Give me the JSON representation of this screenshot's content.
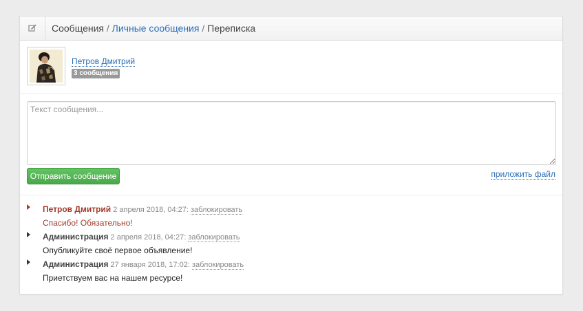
{
  "breadcrumb": {
    "root": "Сообщения",
    "sep1": "/",
    "middle": "Личные сообщения",
    "sep2": "/",
    "current": "Переписка"
  },
  "header": {
    "icon": "edit-icon"
  },
  "user": {
    "name": "Петров Дмитрий",
    "messages_count_badge": "3 сообщения",
    "avatar_icon": "avatar-photo"
  },
  "compose": {
    "placeholder": "Текст сообщения...",
    "value": "",
    "send_label": "Отправить сообщение",
    "attach_label": "приложить файл"
  },
  "colors": {
    "accent": "#2a6eb8",
    "unread": "#a33a2b",
    "send_button": "#5cb85c",
    "badge": "#999999"
  },
  "messages": [
    {
      "author": "Петров Дмитрий",
      "date": "2 апреля 2018, 04:27:",
      "block_label": "заблокировать",
      "text": "Спасибо! Обязательно!",
      "unread": true
    },
    {
      "author": "Администрация",
      "date": "2 апреля 2018, 04:27:",
      "block_label": "заблокировать",
      "text": "Опубликуйте своё первое объявление!",
      "unread": false
    },
    {
      "author": "Администрация",
      "date": "27 января 2018, 17:02:",
      "block_label": "заблокировать",
      "text": "Приетствуем вас на нашем ресурсе!",
      "unread": false
    }
  ]
}
